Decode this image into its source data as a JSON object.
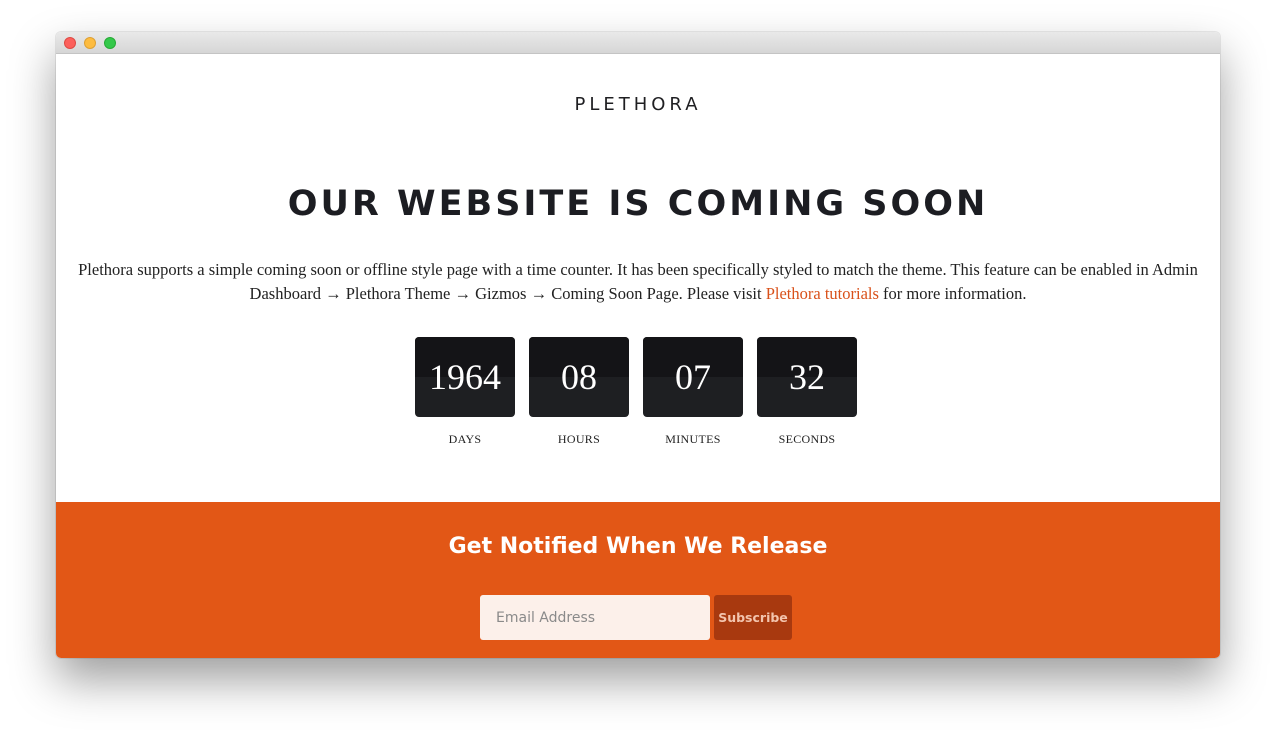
{
  "brand": "PLETHORA",
  "headline": "OUR WEBSITE IS COMING SOON",
  "description": {
    "text_before_link": "Plethora supports a simple coming soon or offline style page with a time counter. It has been specifically styled to match the theme. This feature can be enabled in Admin Dashboard → Plethora Theme → Gizmos → Coming Soon Page. Please visit ",
    "link_text": "Plethora tutorials",
    "text_after_link": " for more information."
  },
  "countdown": [
    {
      "value": "1964",
      "label": "DAYS"
    },
    {
      "value": "08",
      "label": "HOURS"
    },
    {
      "value": "07",
      "label": "MINUTES"
    },
    {
      "value": "32",
      "label": "SECONDS"
    }
  ],
  "notify": {
    "title": "Get Notified When We Release",
    "email_placeholder": "Email Address",
    "subscribe_label": "Subscribe"
  },
  "colors": {
    "accent": "#e25716",
    "button": "#a8390f",
    "link": "#d9511a",
    "counter_bg": "#1e1f22"
  }
}
